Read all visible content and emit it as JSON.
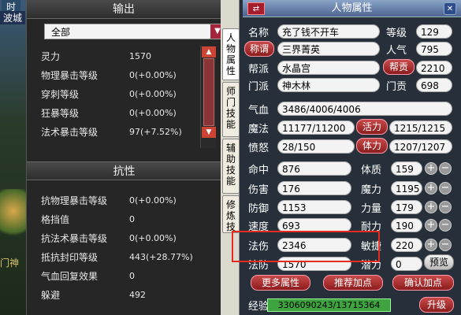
{
  "scene": {
    "top_left_text_a": "时",
    "top_left_text_b": "波城",
    "bottom_left_text": "门神"
  },
  "output_panel": {
    "title": "输出",
    "dropdown_value": "全部",
    "stats": [
      {
        "label": "灵力",
        "value": "1570"
      },
      {
        "label": "物理暴击等级",
        "value": "0(+0.00%)"
      },
      {
        "label": "穿刺等级",
        "value": "0(+0.00%)"
      },
      {
        "label": "狂暴等级",
        "value": "0(+0.00%)"
      },
      {
        "label": "法术暴击等级",
        "value": "97(+7.52%)"
      }
    ]
  },
  "resist_panel": {
    "title": "抗性",
    "stats": [
      {
        "label": "抗物理暴击等级",
        "value": "0(+0.00%)"
      },
      {
        "label": "格挡值",
        "value": "0"
      },
      {
        "label": "抗法术暴击等级",
        "value": "0(+0.00%)"
      },
      {
        "label": "抵抗封印等级",
        "value": "443(+28.77%)"
      },
      {
        "label": "气血回复效果",
        "value": "0"
      },
      {
        "label": "躲避",
        "value": "492"
      }
    ]
  },
  "side_tabs": [
    "人物属性",
    "师门技能",
    "辅助技能",
    "修炼技能"
  ],
  "char_panel": {
    "title": "人物属性",
    "name_label": "名称",
    "name_value": "充了钱不开车",
    "level_label": "等级",
    "level_value": "129",
    "title_button": "称谓",
    "title_value": "三界菁英",
    "popularity_label": "人气",
    "popularity_value": "795",
    "gang_label": "帮派",
    "gang_value": "水晶宫",
    "gang_contrib_button": "帮贡",
    "gang_contrib_value": "2210",
    "sect_label": "门派",
    "sect_value": "神木林",
    "sect_contrib_label": "门贡",
    "sect_contrib_value": "698",
    "hp_label": "气血",
    "hp_value": "3486/4006/4006",
    "mp_label": "魔法",
    "mp_value": "11177/11200",
    "vitality_button": "活力",
    "vitality_value": "1215/1215",
    "anger_label": "愤怒",
    "anger_value": "28/150",
    "stamina_button": "体力",
    "stamina_value": "1207/1207",
    "hit_label": "命中",
    "hit_value": "876",
    "damage_label": "伤害",
    "damage_value": "176",
    "defense_label": "防御",
    "defense_value": "1153",
    "speed_label": "速度",
    "speed_value": "693",
    "mdmg_label": "法伤",
    "mdmg_value": "2346",
    "mdef_label": "法防",
    "mdef_value": "1570",
    "con_label": "体质",
    "con_value": "159",
    "mag_label": "魔力",
    "mag_value": "1195",
    "str_label": "力量",
    "str_value": "179",
    "end_label": "耐力",
    "end_value": "190",
    "agi_label": "敏捷",
    "agi_value": "220",
    "potential_label": "潜力",
    "potential_value": "0",
    "preview_button": "预览",
    "more_button": "更多属性",
    "recommend_button": "推荐加点",
    "confirm_button": "确认加点",
    "exp_label": "经验",
    "exp_value": "3306090243/13715364",
    "levelup_button": "升级"
  },
  "colors": {
    "accent_red": "#a51d2d",
    "exp_green": "#3fa43f",
    "highlight": "#e52a1e"
  }
}
